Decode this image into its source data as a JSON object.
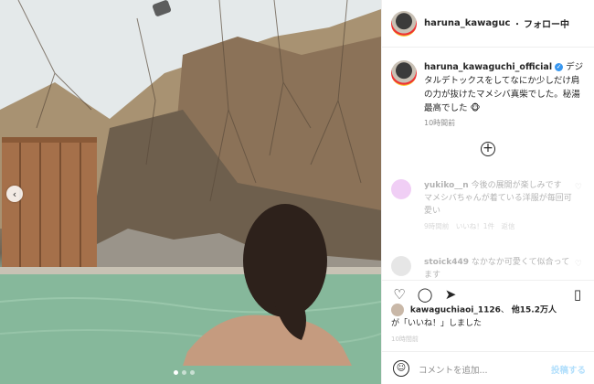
{
  "post": {
    "username": "haruna_kawaguchi_of",
    "follow_label": "フォロー中",
    "caption": {
      "username": "haruna_kawaguchi_official",
      "text": "デジタルデトックスをしてなにか少しだけ肩の力が抜けたマメシバ真柴でした。秘湯最高でした",
      "time": "10時間前"
    },
    "comments": [
      {
        "username": "yukiko__n",
        "text": "今後の展開が楽しみです",
        "text2": "マメシバちゃんが着ている洋服が毎回可愛い",
        "meta": "9時間前　いいね！1件　返信",
        "avatar_color": "#d776e5"
      },
      {
        "username": "stoick449",
        "text": "なかなか可愛くて似合ってます",
        "avatar_color": "#b9b9b9"
      }
    ],
    "likes": {
      "user": "kawaguchiaoi_1126",
      "others": "他15.2万人",
      "suffix": "が「いいね！」しました"
    },
    "ago": "10時間前",
    "add_comment_placeholder": "コメントを追加...",
    "post_button": "投稿する",
    "icons": {
      "heart": "heart-icon",
      "comment": "comment-icon",
      "share": "share-icon",
      "save": "save-icon",
      "emoji": "emoji-icon",
      "add": "plus-circle-icon",
      "prev": "chevron-left-icon"
    }
  }
}
